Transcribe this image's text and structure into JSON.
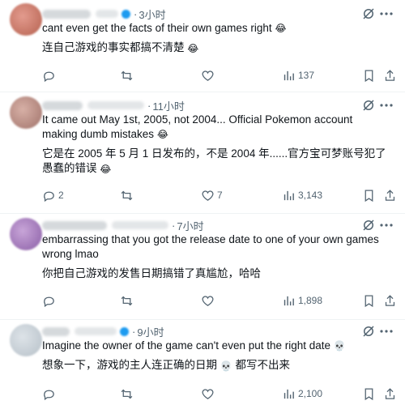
{
  "replies": [
    {
      "time": "3小时",
      "text_en": "cant even get the facts of their own games right",
      "emoji_en": "😂",
      "text_zh": "连自己游戏的事实都搞不清楚",
      "emoji_zh": "😂",
      "replies_count": "",
      "views": "137"
    },
    {
      "time": "11小时",
      "text_en": "It came out May 1st, 2005, not 2004... Official Pokemon account making dumb mistakes",
      "emoji_en": "😂",
      "text_zh": "它是在 2005 年 5 月 1 日发布的，不是 2004 年......官方宝可梦账号犯了愚蠢的错误",
      "emoji_zh": "😂",
      "replies_count": "2",
      "likes": "7",
      "views": "3,143"
    },
    {
      "time": "7小时",
      "text_en": "embarrassing that you got the release date to one of your own games wrong lmao",
      "text_zh": "你把自己游戏的发售日期搞错了真尴尬，哈哈",
      "views": "1,898"
    },
    {
      "time": "9小时",
      "text_en": "Imagine the owner of the game can't even put the right date",
      "emoji_en": "💀",
      "text_zh_a": "想象一下，游戏的主人连正确的日期",
      "emoji_zh": "💀",
      "text_zh_b": "都写不出来",
      "views": "2,100"
    }
  ],
  "icons": [
    "reply-icon",
    "retweet-icon",
    "like-icon",
    "views-icon",
    "bookmark-icon",
    "share-icon",
    "grok-icon",
    "more-icon"
  ],
  "colors": {
    "text": "#0f1419",
    "secondary": "#536471",
    "divider": "#eff3f4"
  }
}
